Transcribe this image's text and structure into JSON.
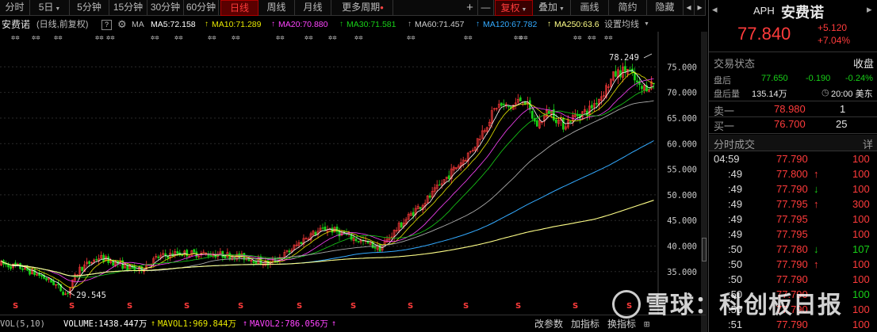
{
  "toolbar": {
    "items": [
      "分时",
      "5日",
      "5分钟",
      "15分钟",
      "30分钟",
      "60分钟",
      "日线",
      "周线",
      "月线",
      "更多周期"
    ],
    "active": "日线",
    "zoom_in": "+",
    "zoom_out": "—",
    "adjust": "复权",
    "overlay": "叠加",
    "draw": "画线",
    "simple": "简约",
    "hide": "隐藏",
    "arrow_left": "◂",
    "arrow_right": "▸"
  },
  "legend": {
    "stock_name": "安费诺",
    "period_info": "(日线,前复权)",
    "help": "?",
    "ma_label": "MA",
    "ma5": "MA5:72.158",
    "ma10": "MA10:71.289",
    "ma20": "MA20:70.880",
    "ma30": "MA30:71.581",
    "ma60": "MA60:71.457",
    "ma120": "MA120:67.782",
    "ma250": "MA250:63.6",
    "settings": "设置均线"
  },
  "colors": {
    "up": "#ff3b3b",
    "down": "#18d018",
    "ma5": "#ffffff",
    "ma10": "#e6e600",
    "ma20": "#ff44ff",
    "ma30": "#18d018",
    "ma60": "#aaaaaa",
    "ma120": "#33aaff",
    "ma250": "#ffff88"
  },
  "chart_data": {
    "type": "candlestick",
    "y_ticks": [
      "75.000",
      "70.000",
      "65.000",
      "60.000",
      "55.000",
      "50.000",
      "45.000",
      "40.000",
      "35.000"
    ],
    "ylim": [
      33.5,
      79
    ],
    "max_label": "78.249",
    "min_label": "29.545",
    "price_path": [
      {
        "x": 0,
        "y": 36.5
      },
      {
        "x": 0.03,
        "y": 35.8
      },
      {
        "x": 0.06,
        "y": 34.2
      },
      {
        "x": 0.08,
        "y": 32.8
      },
      {
        "x": 0.1,
        "y": 30.5
      },
      {
        "x": 0.12,
        "y": 35.5
      },
      {
        "x": 0.15,
        "y": 37.8
      },
      {
        "x": 0.18,
        "y": 36.5
      },
      {
        "x": 0.21,
        "y": 35.2
      },
      {
        "x": 0.24,
        "y": 37.8
      },
      {
        "x": 0.27,
        "y": 38.6
      },
      {
        "x": 0.31,
        "y": 38.5
      },
      {
        "x": 0.35,
        "y": 38.2
      },
      {
        "x": 0.38,
        "y": 37.6
      },
      {
        "x": 0.41,
        "y": 36.5
      },
      {
        "x": 0.44,
        "y": 38.8
      },
      {
        "x": 0.47,
        "y": 42.0
      },
      {
        "x": 0.5,
        "y": 43.5
      },
      {
        "x": 0.53,
        "y": 42.0
      },
      {
        "x": 0.56,
        "y": 40.5
      },
      {
        "x": 0.58,
        "y": 39.5
      },
      {
        "x": 0.6,
        "y": 42.5
      },
      {
        "x": 0.63,
        "y": 46.5
      },
      {
        "x": 0.66,
        "y": 50.0
      },
      {
        "x": 0.69,
        "y": 54.5
      },
      {
        "x": 0.72,
        "y": 58.5
      },
      {
        "x": 0.74,
        "y": 63.0
      },
      {
        "x": 0.76,
        "y": 67.5
      },
      {
        "x": 0.78,
        "y": 67.0
      },
      {
        "x": 0.8,
        "y": 69.0
      },
      {
        "x": 0.82,
        "y": 63.5
      },
      {
        "x": 0.84,
        "y": 66.5
      },
      {
        "x": 0.86,
        "y": 63.5
      },
      {
        "x": 0.88,
        "y": 65.5
      },
      {
        "x": 0.9,
        "y": 66.5
      },
      {
        "x": 0.92,
        "y": 69.5
      },
      {
        "x": 0.94,
        "y": 73.5
      },
      {
        "x": 0.96,
        "y": 74.5
      },
      {
        "x": 0.98,
        "y": 70.5
      },
      {
        "x": 1.0,
        "y": 72.0
      }
    ]
  },
  "bottom": {
    "vol_label": "VOL(5,10)",
    "volume": "VOLUME:1438.447万",
    "mavol1": "MAVOL1:969.844万",
    "mavol2": "MAVOL2:786.056万",
    "change_params": "改参数",
    "add_indicator": "加指标",
    "switch_indicator": "换指标"
  },
  "quote": {
    "symbol": "APH",
    "name": "安费诺",
    "price": "77.840",
    "change": "+5.120",
    "change_pct": "+7.04%",
    "status_label": "交易状态",
    "status_value": "收盘",
    "after_hours_label": "盘后",
    "after_hours_price": "77.650",
    "after_hours_change": "-0.190",
    "after_hours_pct": "-0.24%",
    "after_volume_label": "盘后量",
    "after_volume": "135.14万",
    "after_time": "20:00 美东",
    "ask_label": "卖一",
    "ask_price": "78.980",
    "ask_size": "1",
    "bid_label": "买一",
    "bid_price": "76.700",
    "bid_size": "25"
  },
  "ticks": {
    "title": "分时成交",
    "detail": "详",
    "rows": [
      {
        "time": "04:59",
        "price": "77.790",
        "dir": "",
        "vol": "100",
        "vcolor": "red"
      },
      {
        "time": ":49",
        "price": "77.800",
        "dir": "up",
        "vol": "100",
        "vcolor": "red"
      },
      {
        "time": ":49",
        "price": "77.790",
        "dir": "down",
        "vol": "100",
        "vcolor": "red"
      },
      {
        "time": ":49",
        "price": "77.795",
        "dir": "up",
        "vol": "300",
        "vcolor": "red"
      },
      {
        "time": ":49",
        "price": "77.795",
        "dir": "",
        "vol": "100",
        "vcolor": "red"
      },
      {
        "time": ":49",
        "price": "77.795",
        "dir": "",
        "vol": "100",
        "vcolor": "red"
      },
      {
        "time": ":50",
        "price": "77.780",
        "dir": "down",
        "vol": "107",
        "vcolor": "green"
      },
      {
        "time": ":50",
        "price": "77.790",
        "dir": "up",
        "vol": "100",
        "vcolor": "red"
      },
      {
        "time": ":50",
        "price": "77.790",
        "dir": "",
        "vol": "100",
        "vcolor": "red"
      },
      {
        "time": ":50",
        "price": "77.790",
        "dir": "",
        "vol": "100",
        "vcolor": "green"
      },
      {
        "time": ":50",
        "price": "77.790",
        "dir": "",
        "vol": "100",
        "vcolor": "red"
      },
      {
        "time": ":51",
        "price": "77.790",
        "dir": "",
        "vol": "100",
        "vcolor": "red"
      }
    ]
  },
  "watermark": "雪球：科创板日报"
}
